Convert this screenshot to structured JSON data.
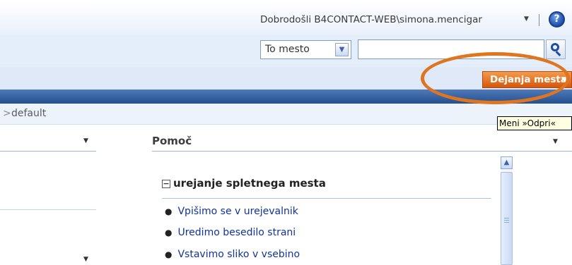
{
  "header": {
    "welcome_text": "Dobrodošli B4CONTACT-WEB\\simona.mencigar",
    "welcome_arrow": "▼",
    "help_symbol": "?"
  },
  "search": {
    "scope_value": "To mesto",
    "scope_arrow": "▼",
    "query_value": "",
    "search_icon": "magnifier-icon"
  },
  "site_actions": {
    "label": "Dejanja mesta",
    "arrow": "▼"
  },
  "breadcrumb": {
    "separator": ">",
    "current": "default"
  },
  "tooltip": {
    "text": "Meni »Odpri«"
  },
  "left_webpart": {
    "menu_arrow": "▼",
    "menu_arrow_2": "▼"
  },
  "help_pane": {
    "title": "Pomoč",
    "title_arrow": "▼",
    "section": {
      "toggle": "−",
      "title": "urejanje spletnega mesta",
      "links": [
        "Vpišimo se v urejevalnik",
        "Uredimo besedilo strani",
        "Vstavimo sliko v vsebino"
      ]
    },
    "scroll_up_arrow": "▲"
  },
  "colors": {
    "site_actions_bg": "#e0751f",
    "highlight_ring": "#e0751f",
    "link": "#10339a",
    "header_band": "#23508f"
  }
}
